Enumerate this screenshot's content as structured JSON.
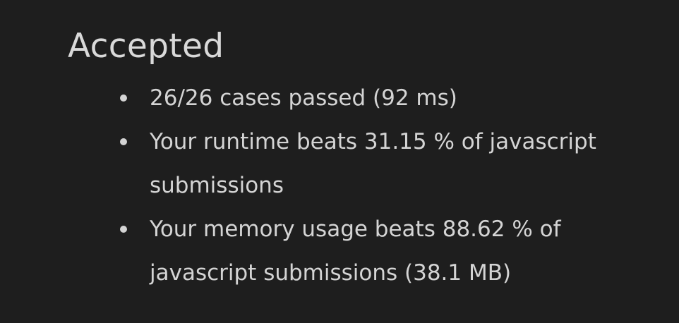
{
  "result": {
    "title": "Accepted",
    "items": [
      {
        "lines": [
          "26/26 cases passed (92 ms)"
        ]
      },
      {
        "lines": [
          "Your runtime beats 31.15 % of javascript",
          "submissions"
        ]
      },
      {
        "lines": [
          "Your memory usage beats 88.62 % of",
          "javascript submissions (38.1 MB)"
        ]
      }
    ]
  }
}
